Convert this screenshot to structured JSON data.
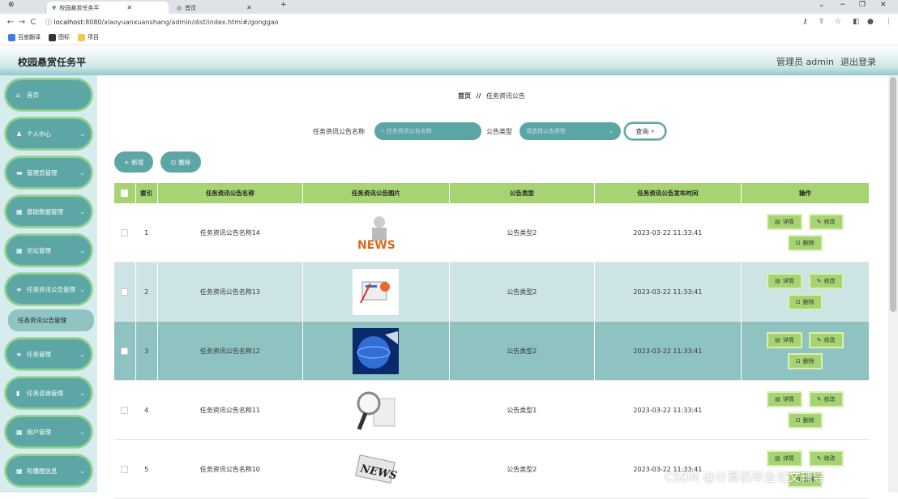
{
  "browser": {
    "tabs": [
      {
        "title": "校园悬赏任务平",
        "active": true
      },
      {
        "title": "首页",
        "active": false
      }
    ],
    "url_host": "localhost",
    "url_rest": ":8080/xiaoyuanxuanshang/admin/dist/index.html#/gonggao",
    "bookmarks": [
      "百度翻译",
      "图标",
      "项目"
    ]
  },
  "header": {
    "title": "校园悬赏任务平",
    "user": "管理员 admin",
    "logout": "退出登录"
  },
  "sidebar": {
    "items": [
      {
        "label": "首页",
        "icon": "home-icon",
        "expandable": false
      },
      {
        "label": "个人中心",
        "icon": "user-icon",
        "expandable": true
      },
      {
        "label": "管理员管理",
        "icon": "card-icon",
        "expandable": true
      },
      {
        "label": "基础数据管理",
        "icon": "grid-icon",
        "expandable": true
      },
      {
        "label": "论坛管理",
        "icon": "grid-icon",
        "expandable": true
      },
      {
        "label": "任务资讯公告管理",
        "icon": "list-icon",
        "expandable": true
      },
      {
        "label": "任务管理",
        "icon": "list-icon",
        "expandable": true
      },
      {
        "label": "任务咨询管理",
        "icon": "doc-icon",
        "expandable": true
      },
      {
        "label": "用户管理",
        "icon": "grid-icon",
        "expandable": true
      },
      {
        "label": "轮播图信息",
        "icon": "grid-icon",
        "expandable": true
      }
    ],
    "submenu": "任务资讯公告管理"
  },
  "breadcrumb": {
    "home": "首页",
    "sep": "//",
    "current": "任务资讯公告"
  },
  "search": {
    "name_label": "任务资讯公告名称",
    "name_placeholder": "任务资讯公告名称",
    "type_label": "公告类型",
    "type_placeholder": "请选择公告类型",
    "query": "查询"
  },
  "actions": {
    "add": "新增",
    "delete": "删除"
  },
  "table": {
    "headers": [
      "索引",
      "任务资讯公告名称",
      "任务资讯公告图片",
      "公告类型",
      "任务资讯公告发布时间",
      "操作"
    ],
    "ops": {
      "detail": "详情",
      "edit": "修改",
      "delete": "删除"
    },
    "rows": [
      {
        "index": "1",
        "name": "任务资讯公告名称14",
        "type": "公告类型2",
        "time": "2023-03-22 11:33:41",
        "image": "news-3d-figure"
      },
      {
        "index": "2",
        "name": "任务资讯公告名称13",
        "type": "公告类型2",
        "time": "2023-03-22 11:33:41",
        "image": "news-paper-pencil"
      },
      {
        "index": "3",
        "name": "任务资讯公告名称12",
        "type": "公告类型2",
        "time": "2023-03-22 11:33:41",
        "image": "news-globe"
      },
      {
        "index": "4",
        "name": "任务资讯公告名称11",
        "type": "公告类型1",
        "time": "2023-03-22 11:33:41",
        "image": "news-magnifier"
      },
      {
        "index": "5",
        "name": "任务资讯公告名称10",
        "type": "公告类型2",
        "time": "2023-03-22 11:33:41",
        "image": "news-paper"
      }
    ]
  },
  "watermark": "CSDN @计算机毕业论文辅导",
  "colors": {
    "accent": "#5ca7a5",
    "header_green": "#a7d472",
    "row_alt1": "#cde4e4",
    "row_alt2": "#8fc3c2"
  }
}
